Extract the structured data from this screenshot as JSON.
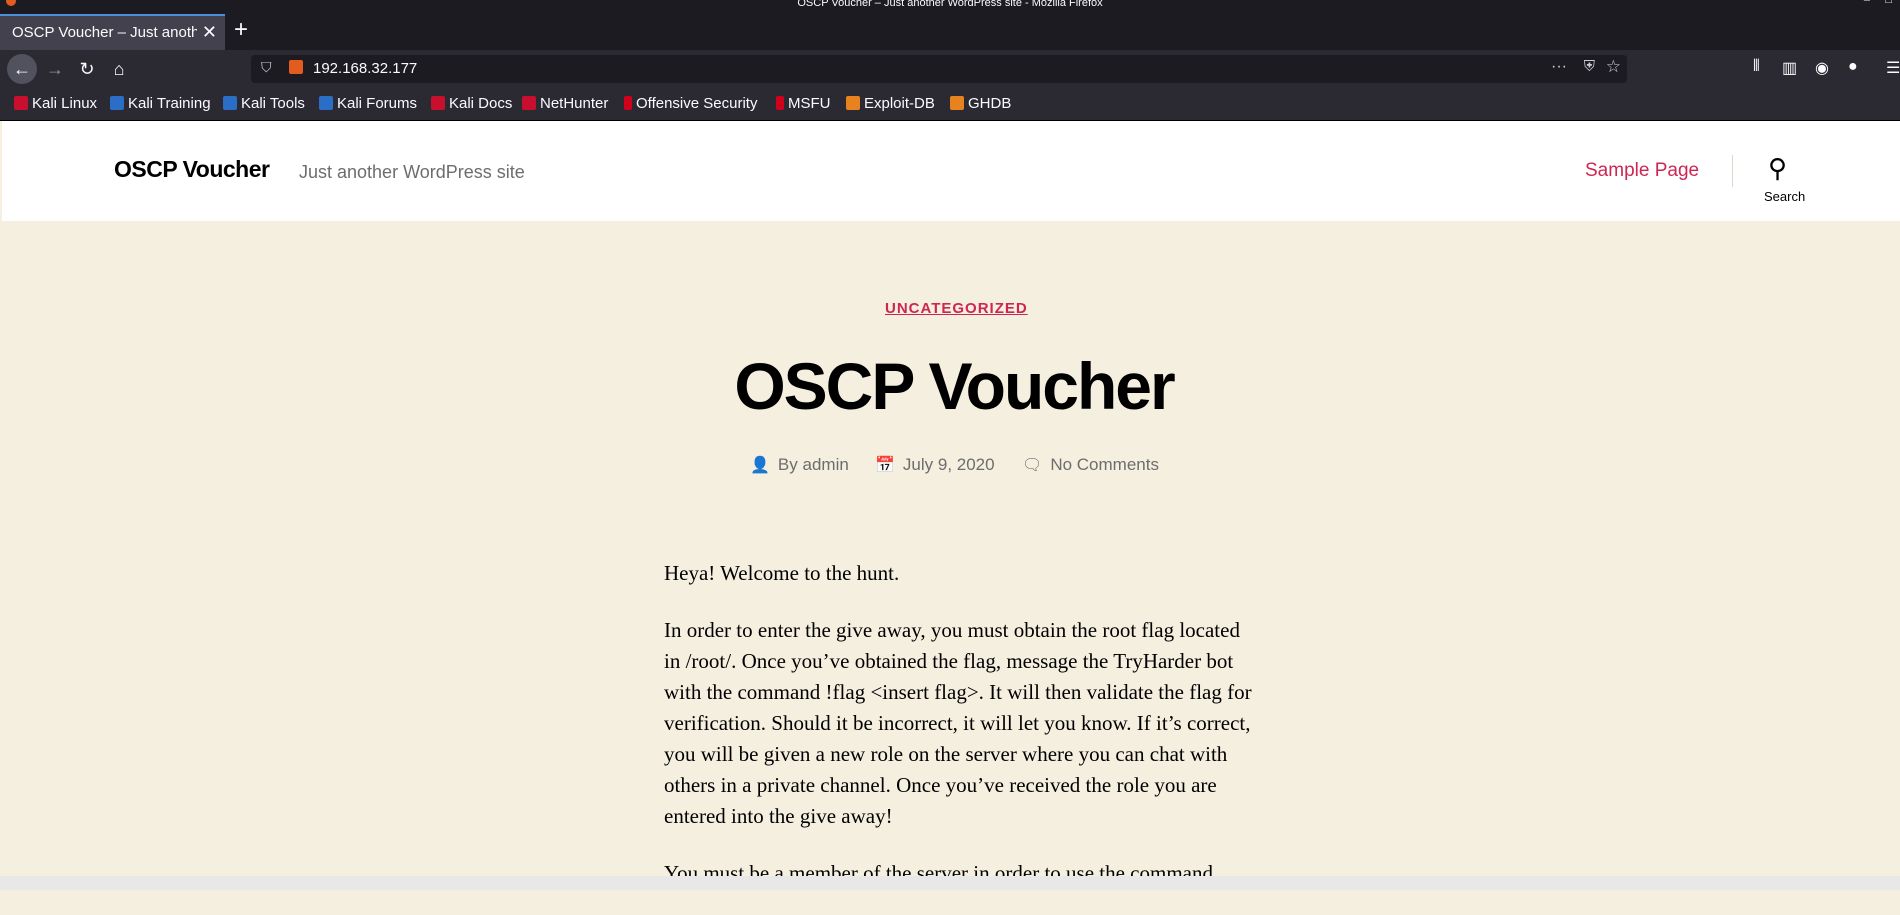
{
  "window": {
    "title": "OSCP Voucher – Just another WordPress site - Mozilla Firefox"
  },
  "tabs": [
    {
      "title": "OSCP Voucher – Just another WordPress site",
      "close": "✕"
    }
  ],
  "new_tab_symbol": "+",
  "url": "192.168.32.177",
  "bookmarks": [
    {
      "label": "Kali Linux",
      "icon": "kali-dragon-icon"
    },
    {
      "label": "Kali Training",
      "icon": "kali-training-icon"
    },
    {
      "label": "Kali Tools",
      "icon": "kali-tools-icon"
    },
    {
      "label": "Kali Forums",
      "icon": "kali-forums-icon"
    },
    {
      "label": "Kali Docs",
      "icon": "kali-docs-icon"
    },
    {
      "label": "NetHunter",
      "icon": "nethunter-icon"
    },
    {
      "label": "Offensive Security",
      "icon": "offsec-icon"
    },
    {
      "label": "MSFU",
      "icon": "msfu-icon"
    },
    {
      "label": "Exploit-DB",
      "icon": "exploit-db-icon"
    },
    {
      "label": "GHDB",
      "icon": "ghdb-icon"
    }
  ],
  "site": {
    "title": "OSCP Voucher",
    "tagline": "Just another WordPress site",
    "nav_link": "Sample Page",
    "search_label": "Search"
  },
  "post": {
    "category": "UNCATEGORIZED",
    "title": "OSCP Voucher",
    "author_prefix": "By",
    "author": "admin",
    "date": "July 9, 2020",
    "comments": "No Comments",
    "paragraphs": [
      "Heya! Welcome to the hunt.",
      "In order to enter the give away, you must obtain the root flag located in /root/. Once you’ve obtained the flag, message the TryHarder bot with the command !flag <insert flag>. It will then validate the flag for verification. Should it be incorrect, it will let you know. If it’s correct, you will be given a new role on the server where you can chat with others in a private channel. Once you’ve received the role you are entered into the give away!",
      "You must be a member of the server in order to use the command"
    ]
  },
  "colors": {
    "accent": "#cd2653",
    "background": "#f5efe0",
    "header_bg": "#ffffff",
    "browser_chrome": "#2b2a33"
  }
}
